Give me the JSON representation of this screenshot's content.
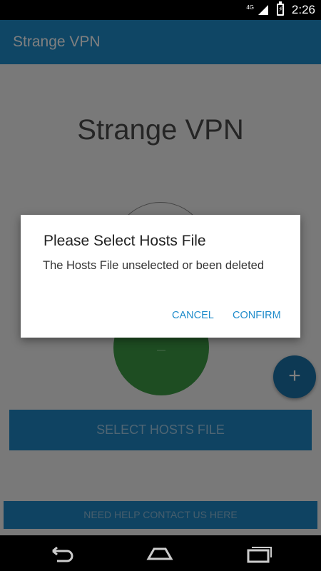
{
  "status_bar": {
    "network": "4G",
    "time": "2:26"
  },
  "app_bar": {
    "title": "Strange VPN"
  },
  "main": {
    "title": "Strange VPN",
    "fab_label": "+",
    "select_button": "SELECT HOSTS FILE",
    "help_button": "NEED HELP CONTACT US HERE"
  },
  "dialog": {
    "title": "Please Select Hosts File",
    "message": "The Hosts File unselected or been deleted",
    "cancel": "CANCEL",
    "confirm": "CONFIRM"
  },
  "nav": {
    "back": "back-icon",
    "home": "home-icon",
    "recents": "recents-icon"
  },
  "colors": {
    "primary": "#1f8ccb",
    "toggle_on": "#3d9a45",
    "fab": "#1a73a8"
  }
}
